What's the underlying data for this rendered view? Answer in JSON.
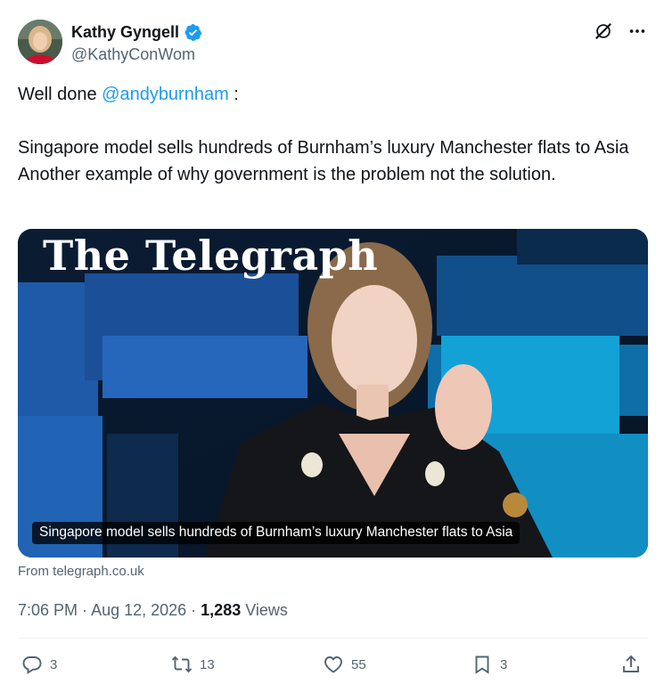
{
  "author": {
    "display_name": "Kathy Gyngell",
    "handle": "@KathyConWom",
    "verified": true
  },
  "header_actions": [
    "grok-icon",
    "more-icon"
  ],
  "tweet": {
    "line1_prefix": "Well done ",
    "mention": "@andyburnham",
    "line1_suffix": " :",
    "line2": "Singapore model sells hundreds of Burnham’s luxury Manchester flats to Asia",
    "line3": "Another example of why government is the problem not the solution."
  },
  "card": {
    "masthead": "The Telegraph",
    "caption": "Singapore model sells hundreds of Burnham’s luxury Manchester flats to Asia",
    "source": "From telegraph.co.uk"
  },
  "meta": {
    "time": "7:06 PM",
    "date": "Aug 12, 2026",
    "views_count": "1,283",
    "views_label": "Views"
  },
  "actions": {
    "replies": "3",
    "retweets": "13",
    "likes": "55",
    "bookmarks": "3"
  },
  "colors": {
    "accent": "#1d9bf0",
    "muted": "#536471",
    "text": "#0f1419"
  }
}
